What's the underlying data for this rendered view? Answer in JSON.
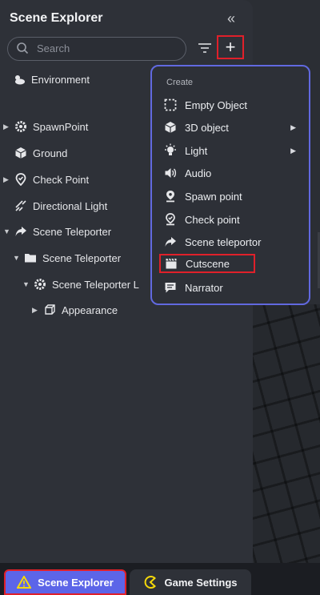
{
  "panel": {
    "title": "Scene Explorer",
    "collapse_icon": "double-chevron-left-icon",
    "search": {
      "placeholder": "Search"
    },
    "filter_icon": "filter-icon",
    "add_icon": "plus-icon"
  },
  "tree": [
    {
      "label": "Environment",
      "icon": "cloud-sun-icon"
    },
    {
      "label": "SpawnPoint",
      "icon": "gear-icon"
    },
    {
      "label": "Ground",
      "icon": "cube-icon"
    },
    {
      "label": "Check Point",
      "icon": "location-check-icon"
    },
    {
      "label": "Directional Light",
      "icon": "light-rays-icon"
    },
    {
      "label": "Scene Teleporter",
      "icon": "share-arrow-icon"
    },
    {
      "label": "Scene Teleporter",
      "icon": "folder-icon"
    },
    {
      "label": "Scene Teleporter L",
      "icon": "gear-icon"
    },
    {
      "label": "Appearance",
      "icon": "cube-outline-icon"
    }
  ],
  "menu": {
    "header": "Create",
    "items": [
      {
        "label": "Empty Object",
        "icon": "dashed-square-icon",
        "submenu": false
      },
      {
        "label": "3D object",
        "icon": "cube-icon",
        "submenu": true
      },
      {
        "label": "Light",
        "icon": "lightbulb-icon",
        "submenu": true
      },
      {
        "label": "Audio",
        "icon": "speaker-icon",
        "submenu": false
      },
      {
        "label": "Spawn point",
        "icon": "location-pin-icon",
        "submenu": false
      },
      {
        "label": "Check point",
        "icon": "location-check-icon",
        "submenu": false
      },
      {
        "label": "Scene teleportor",
        "icon": "share-arrow-icon",
        "submenu": false
      },
      {
        "label": "Cutscene",
        "icon": "clapperboard-icon",
        "submenu": false
      },
      {
        "label": "Narrator",
        "icon": "chat-bubble-icon",
        "submenu": false
      }
    ]
  },
  "tabs": [
    {
      "label": "Scene Explorer",
      "icon": "warning-triangle-icon",
      "active": true
    },
    {
      "label": "Game Settings",
      "icon": "pacman-icon",
      "active": false
    }
  ],
  "colors": {
    "accent": "#5c65e8",
    "menu_border": "#6169e0",
    "highlight_red": "#e0202a",
    "panel_bg": "#2e3138"
  }
}
